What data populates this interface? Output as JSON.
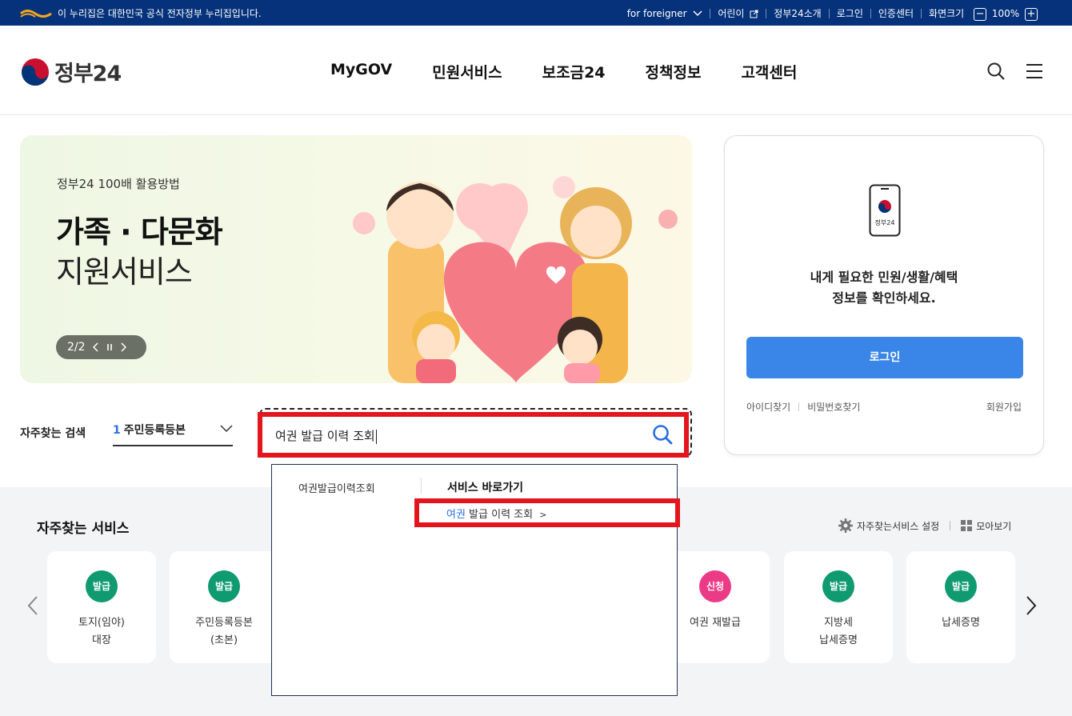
{
  "topbar": {
    "gov_notice": "이 누리집은 대한민국 공식 전자정부 누리집입니다.",
    "items": [
      "for foreigner",
      "어린이",
      "정부24소개",
      "로그인",
      "인증센터",
      "화면크기"
    ],
    "zoom": "100%"
  },
  "header": {
    "logo": "정부24",
    "nav": [
      "MyGOV",
      "민원서비스",
      "보조금24",
      "정책정보",
      "고객센터"
    ]
  },
  "hero": {
    "subtitle": "정부24 100배 활용방법",
    "title1": "가족 · 다문화",
    "title2": "지원서비스",
    "pager": "2/2"
  },
  "login": {
    "phone_label": "정부24",
    "message1": "내게 필요한 민원/생활/혜택",
    "message2": "정보를 확인하세요.",
    "button": "로그인",
    "find_id": "아이디찾기",
    "find_pw": "비밀번호찾기",
    "join": "회원가입"
  },
  "search": {
    "label": "자주찾는 검색",
    "select_num": "1",
    "select_text": "주민등록등본",
    "value": "여권 발급 이력 조회"
  },
  "dropdown": {
    "keyword": "여권발급이력조회",
    "heading": "서비스 바로가기",
    "suggestion_highlight": "여권",
    "suggestion_rest": " 발급 이력 조회",
    "suggestion_arrow": ">"
  },
  "services": {
    "title": "자주찾는 서비스",
    "settings": "자주찾는서비스 설정",
    "view_all": "모아보기",
    "cards": [
      {
        "badge": "발급",
        "line1": "토지(임야)",
        "line2": "대장",
        "color": "#0f9a6f"
      },
      {
        "badge": "발급",
        "line1": "주민등록등본",
        "line2": "(초본)",
        "color": "#0f9a6f"
      },
      {
        "badge": "신청",
        "line1": "여권 재발급",
        "line2": "",
        "color": "#ec3b86"
      },
      {
        "badge": "발급",
        "line1": "지방세",
        "line2": "납세증명",
        "color": "#0f9a6f"
      },
      {
        "badge": "발급",
        "line1": "납세증명",
        "line2": "",
        "color": "#0f9a6f"
      }
    ]
  }
}
